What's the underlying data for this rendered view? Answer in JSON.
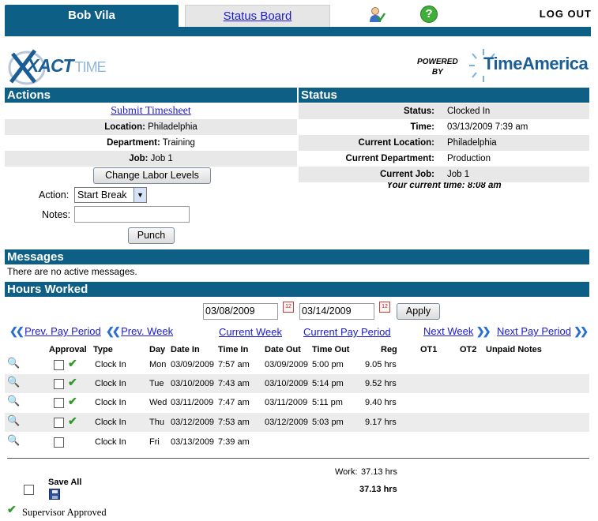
{
  "header": {
    "user_tab": "Bob Vila",
    "status_tab": "Status Board",
    "logout": "LOG OUT",
    "help_glyph": "?"
  },
  "branding": {
    "xact": "XACT",
    "time": "TIME",
    "powered_by_line1": "POWERED",
    "powered_by_line2": "BY",
    "timeamerica": "TimeAmerica"
  },
  "actions": {
    "title": "Actions",
    "submit_link": "Submit Timesheet",
    "location_label": "Location:",
    "location_value": "Philadelphia",
    "department_label": "Department:",
    "department_value": "Training",
    "job_label": "Job:",
    "job_value": "Job 1",
    "change_button": "Change Labor Levels",
    "action_label": "Action:",
    "action_value": "Start Break",
    "notes_label": "Notes:",
    "notes_value": "",
    "punch_button": "Punch"
  },
  "status": {
    "title": "Status",
    "status_label": "Status:",
    "status_value": "Clocked In",
    "time_label": "Time:",
    "time_value": "03/13/2009 7:39 am",
    "cur_location_label": "Current Location:",
    "cur_location_value": "Philadelphia",
    "cur_department_label": "Current Department:",
    "cur_department_value": "Production",
    "cur_job_label": "Current Job:",
    "cur_job_value": "Job 1",
    "current_time": "Your current time: 8:08 am"
  },
  "messages": {
    "title": "Messages",
    "text": "There are no active messages."
  },
  "hours": {
    "title": "Hours Worked",
    "start_date": "03/08/2009",
    "end_date": "03/14/2009",
    "apply_button": "Apply",
    "calendar_glyph": "12",
    "nav": {
      "prev_pay_period": "Prev. Pay Period",
      "prev_week": "Prev. Week",
      "current_week": "Current Week",
      "current_pay_period": "Current Pay Period",
      "next_week": "Next Week",
      "next_pay_period": "Next Pay Period"
    },
    "columns": {
      "approval": "Approval",
      "type": "Type",
      "day": "Day",
      "date_in": "Date In",
      "time_in": "Time In",
      "date_out": "Date Out",
      "time_out": "Time Out",
      "reg": "Reg",
      "ot1": "OT1",
      "ot2": "OT2",
      "unpaid_notes": "Unpaid Notes"
    },
    "rows": [
      {
        "type": "Clock In",
        "day": "Mon",
        "date_in": "03/09/2009",
        "time_in": "7:57 am",
        "date_out": "03/09/2009",
        "time_out": "5:00 pm",
        "reg": "9.05 hrs",
        "approved": true
      },
      {
        "type": "Clock In",
        "day": "Tue",
        "date_in": "03/10/2009",
        "time_in": "7:43 am",
        "date_out": "03/10/2009",
        "time_out": "5:14 pm",
        "reg": "9.52 hrs",
        "approved": true
      },
      {
        "type": "Clock In",
        "day": "Wed",
        "date_in": "03/11/2009",
        "time_in": "7:47 am",
        "date_out": "03/11/2009",
        "time_out": "5:11 pm",
        "reg": "9.40 hrs",
        "approved": true
      },
      {
        "type": "Clock In",
        "day": "Thu",
        "date_in": "03/12/2009",
        "time_in": "7:53 am",
        "date_out": "03/12/2009",
        "time_out": "5:03 pm",
        "reg": "9.17 hrs",
        "approved": true
      },
      {
        "type": "Clock In",
        "day": "Fri",
        "date_in": "03/13/2009",
        "time_in": "7:39 am",
        "date_out": "",
        "time_out": "",
        "reg": "",
        "approved": false
      }
    ],
    "work_total_label": "Work:",
    "work_total_value": "37.13 hrs",
    "grand_total": "37.13 hrs",
    "save_all": "Save All",
    "legend": "Supervisor Approved"
  }
}
